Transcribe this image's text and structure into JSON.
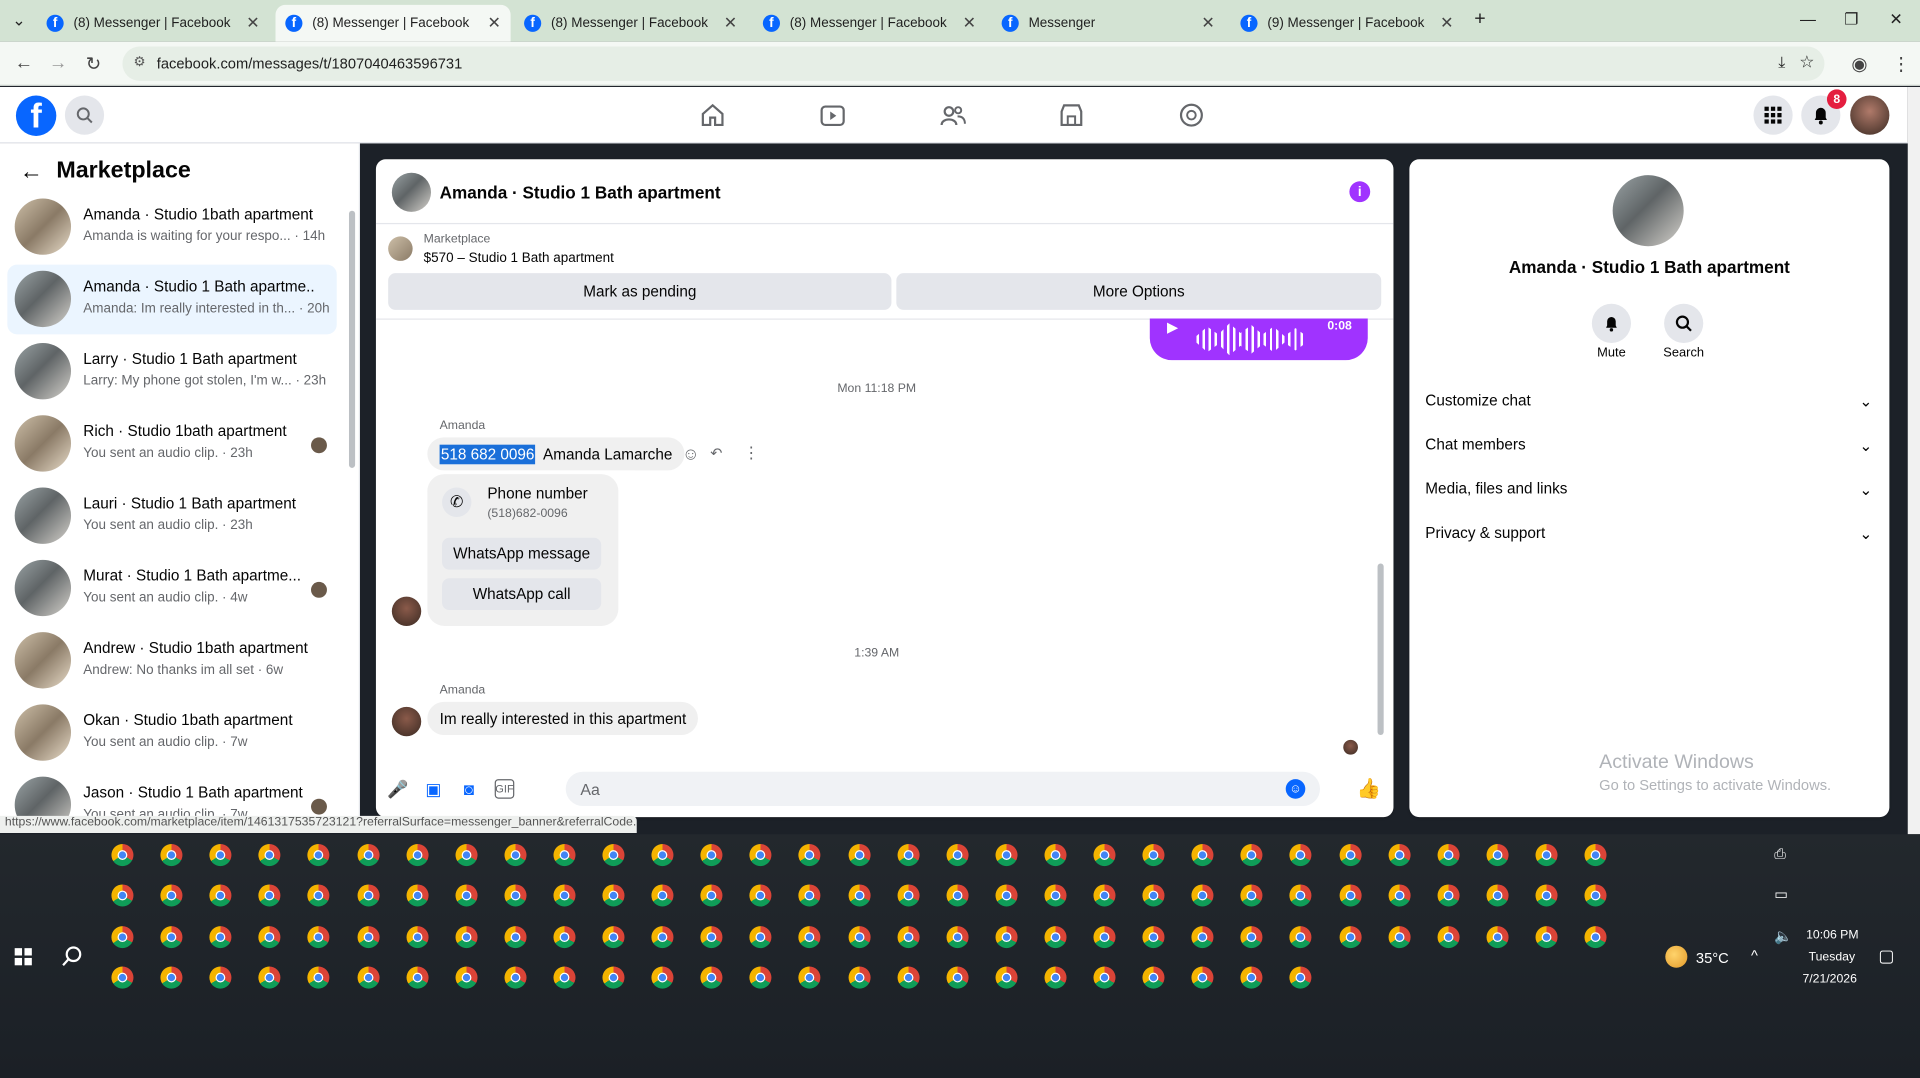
{
  "browser": {
    "tabs": [
      {
        "title": "(8) Messenger | Facebook",
        "active": false
      },
      {
        "title": "(8) Messenger | Facebook",
        "active": true
      },
      {
        "title": "(8) Messenger | Facebook",
        "active": false
      },
      {
        "title": "(8) Messenger | Facebook",
        "active": false
      },
      {
        "title": "Messenger",
        "active": false
      },
      {
        "title": "(9) Messenger | Facebook",
        "active": false
      }
    ],
    "url": "facebook.com/messages/t/1807040463596731",
    "status_url": "https://www.facebook.com/marketplace/item/1461317535723121?referralSurface=messenger_banner&referralCode..."
  },
  "fb": {
    "notification_count": "8"
  },
  "sidebar": {
    "title": "Marketplace",
    "conversations": [
      {
        "name": "Amanda · Studio 1bath apartment",
        "preview": "Amanda is waiting for your respo... · 14h"
      },
      {
        "name": "Amanda · Studio 1 Bath apartme...",
        "preview": "Amanda: Im really interested in th... · 20h"
      },
      {
        "name": "Larry · Studio 1 Bath apartment",
        "preview": "Larry: My phone got stolen, I'm w... · 23h"
      },
      {
        "name": "Rich · Studio 1bath apartment",
        "preview": "You sent an audio clip. · 23h"
      },
      {
        "name": "Lauri · Studio 1 Bath apartment",
        "preview": "You sent an audio clip. · 23h"
      },
      {
        "name": "Murat · Studio 1 Bath apartme...",
        "preview": "You sent an audio clip. · 4w"
      },
      {
        "name": "Andrew · Studio 1bath apartment",
        "preview": "Andrew: No thanks im all set · 6w"
      },
      {
        "name": "Okan · Studio 1bath apartment",
        "preview": "You sent an audio clip. · 7w"
      },
      {
        "name": "Jason · Studio 1 Bath apartment",
        "preview": "You sent an audio clip. · 7w"
      }
    ]
  },
  "chat": {
    "title": "Amanda · Studio 1 Bath apartment",
    "marketplace_label": "Marketplace",
    "listing": "$570 – Studio 1 Bath apartment",
    "mark_pending": "Mark as pending",
    "more_options": "More Options",
    "voice_duration": "0:08",
    "stamp1": "Mon 11:18 PM",
    "stamp2": "1:39 AM",
    "sender": "Amanda",
    "msg1_highlight": "518 682 0096",
    "msg1_rest": "Amanda Lamarche",
    "phone_card_title": "Phone number",
    "phone_card_value": "(518)682-0096",
    "whatsapp_message": "WhatsApp message",
    "whatsapp_call": "WhatsApp call",
    "msg2": "Im really interested in this apartment",
    "composer_placeholder": "Aa"
  },
  "details": {
    "name": "Amanda · Studio 1 Bath apartment",
    "mute": "Mute",
    "search": "Search",
    "sections": [
      "Customize chat",
      "Chat members",
      "Media, files and links",
      "Privacy & support"
    ],
    "watermark_title": "Activate Windows",
    "watermark_sub": "Go to Settings to activate Windows."
  },
  "taskbar": {
    "temperature": "35°C",
    "time": "10:06 PM",
    "day": "Tuesday",
    "date": "7/21/2026"
  },
  "colors": {
    "fb_blue": "#0866ff",
    "messenger_purple": "#a033ff",
    "selected_row": "#ebf5ff"
  }
}
